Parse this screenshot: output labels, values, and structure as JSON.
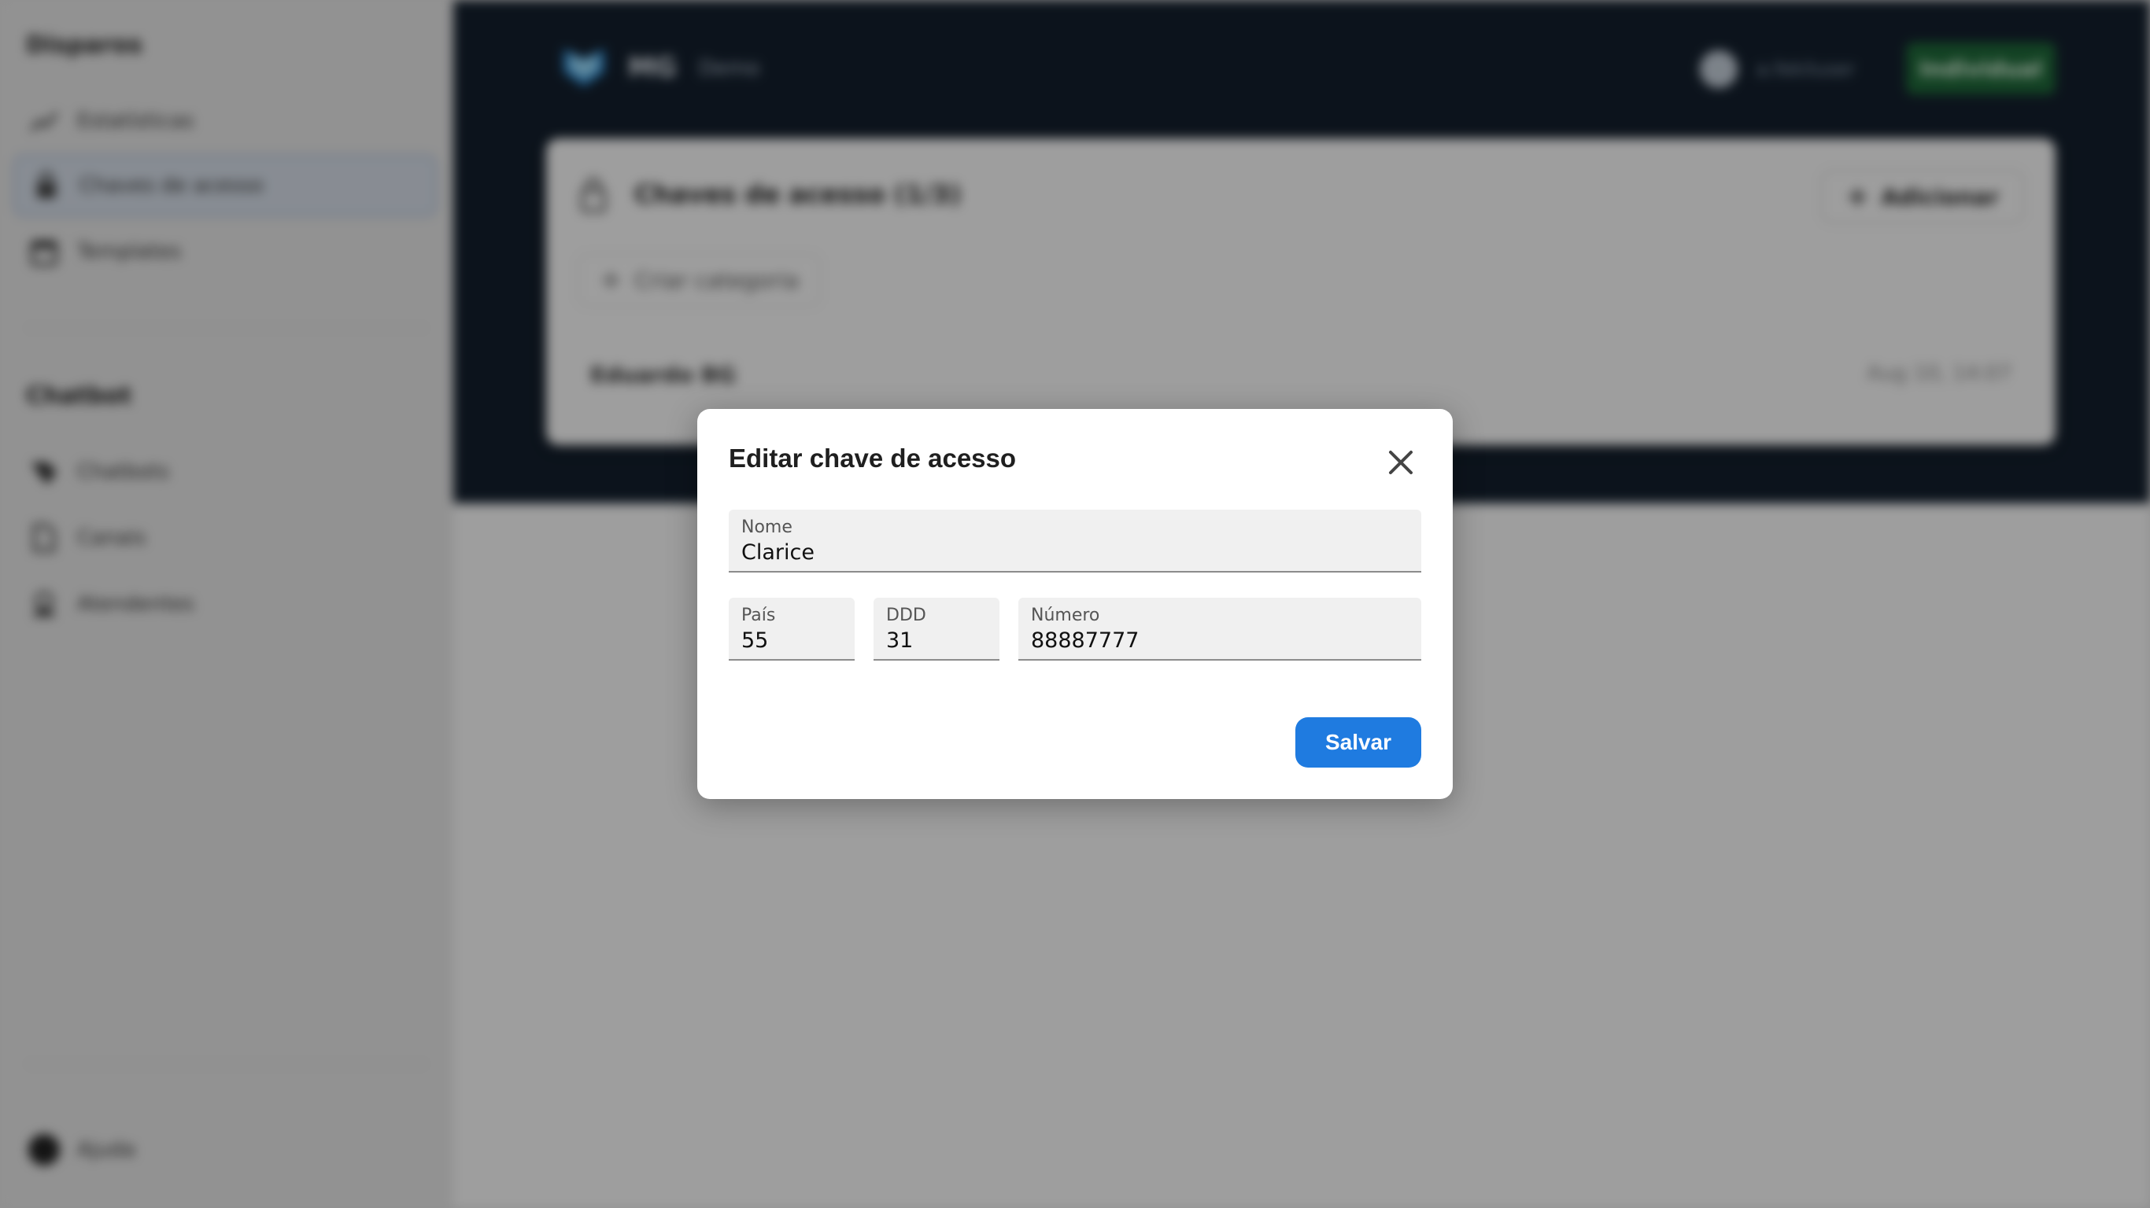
{
  "colors": {
    "accent": "#1f7be0",
    "overlay": "rgba(0,0,0,0.38)",
    "plan_badge": "#1f6b3a"
  },
  "sidebar": {
    "section_disparos": "Disparos",
    "items_disparos": [
      {
        "label": "Estatísticas",
        "icon": "chart-trend-icon"
      },
      {
        "label": "Chaves de acesso",
        "icon": "lock-icon",
        "active": true
      },
      {
        "label": "Templates",
        "icon": "calendar-icon"
      }
    ],
    "section_chatbot": "Chatbot",
    "items_chatbot": [
      {
        "label": "Chatbots",
        "icon": "bot-icon"
      },
      {
        "label": "Canais",
        "icon": "channel-icon"
      },
      {
        "label": "Atendentes",
        "icon": "agents-icon"
      }
    ],
    "help_label": "Ajuda"
  },
  "topbar": {
    "brand": "MG",
    "subtitle": "Demo",
    "user": "a.fekiluser",
    "plan": "Individual"
  },
  "card": {
    "title": "Chaves de acesso (1/3)",
    "add_label": "Adicionar",
    "category_label": "Criar categoria",
    "row_name": "Eduardo BG",
    "row_date": "Aug 10, 14:07"
  },
  "modal": {
    "title": "Editar chave de acesso",
    "nome": {
      "label": "Nome",
      "value": "Clarice"
    },
    "pais": {
      "label": "País",
      "value": "55"
    },
    "ddd": {
      "label": "DDD",
      "value": "31"
    },
    "numero": {
      "label": "Número",
      "value": "88887777"
    },
    "save_label": "Salvar"
  }
}
